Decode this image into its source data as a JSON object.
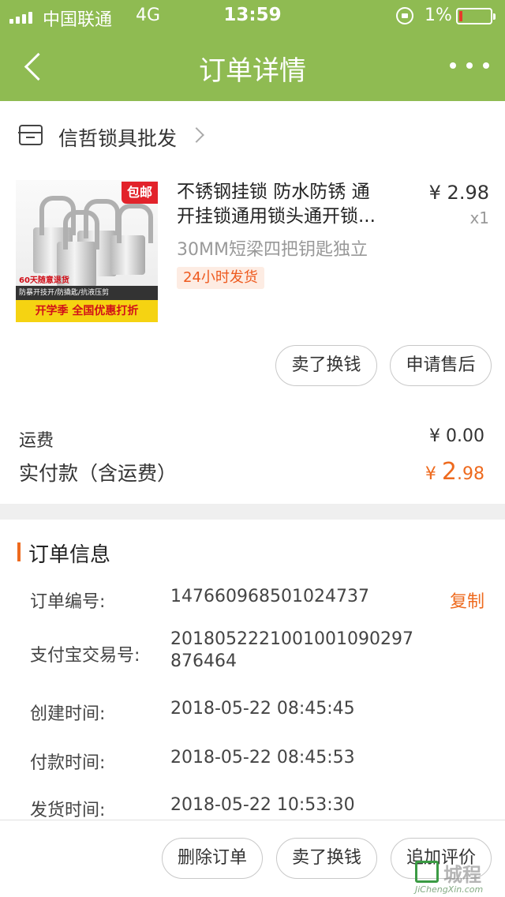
{
  "status_bar": {
    "carrier": "中国联通",
    "network": "4G",
    "time": "13:59",
    "battery": "1%"
  },
  "nav": {
    "title": "订单详情"
  },
  "shop": {
    "name": "信哲锁具批发"
  },
  "product": {
    "title_line1": "不锈钢挂锁 防水防锈 通",
    "title_line2": "开挂锁通用锁头通开锁...",
    "price": "¥ 2.98",
    "quantity": "x1",
    "spec": "30MM短梁四把钥匙独立",
    "tag": "24小时发货",
    "image_texts": {
      "badge": "包邮",
      "return": "60天随意退货",
      "strip": "防暴开技开/防撬匙/抗液压剪",
      "banner": "开学季 全国优惠打折"
    }
  },
  "item_actions": {
    "sell": "卖了换钱",
    "after_sale": "申请售后"
  },
  "fees": {
    "shipping_label": "运费",
    "shipping_value": "¥ 0.00",
    "paid_label": "实付款（含运费）",
    "paid_currency": "¥ ",
    "paid_int": "2",
    "paid_dec": ".98"
  },
  "order_info": {
    "heading": "订单信息",
    "copy": "复制",
    "rows": [
      {
        "label": "订单编号:",
        "value": "147660968501024737"
      },
      {
        "label": "支付宝交易号:",
        "value_line1": "2018052221001001090297",
        "value_line2": "876464"
      },
      {
        "label": "创建时间:",
        "value": "2018-05-22 08:45:45"
      },
      {
        "label": "付款时间:",
        "value": "2018-05-22 08:45:53"
      },
      {
        "label": "发货时间:",
        "value": "2018-05-22 10:53:30"
      }
    ]
  },
  "bottom_actions": {
    "delete": "删除订单",
    "sell": "卖了换钱",
    "review": "追加评价"
  },
  "watermark": {
    "cn": "城程",
    "en": "JiChengXin.com"
  },
  "colors": {
    "nav_green": "#8fbb52",
    "accent_orange": "#ee6a1e"
  }
}
